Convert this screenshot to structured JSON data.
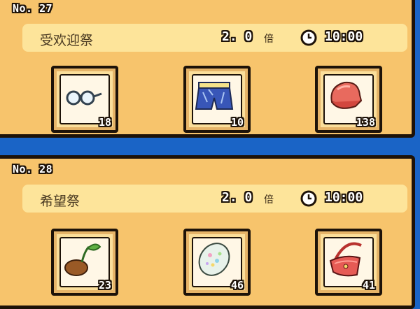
{
  "festivals": [
    {
      "number_label": "No. 27",
      "name": "受欢迎祭",
      "multiplier": "2. 0",
      "multiplier_suffix": "倍",
      "time": "10:00",
      "items": [
        {
          "icon": "glasses-icon",
          "count": "18"
        },
        {
          "icon": "shorts-icon",
          "count": "10"
        },
        {
          "icon": "cap-icon",
          "count": "138"
        }
      ]
    },
    {
      "number_label": "No. 28",
      "name": "希望祭",
      "multiplier": "2. 0",
      "multiplier_suffix": "倍",
      "time": "10:00",
      "items": [
        {
          "icon": "seed-sprout-icon",
          "count": "23"
        },
        {
          "icon": "opal-gem-icon",
          "count": "46"
        },
        {
          "icon": "shoulder-bag-icon",
          "count": "41"
        }
      ]
    }
  ],
  "colors": {
    "background": "#1a64c6",
    "panel": "#f7c46c",
    "info_bar": "#fde49a",
    "outline": "#1d1208"
  }
}
